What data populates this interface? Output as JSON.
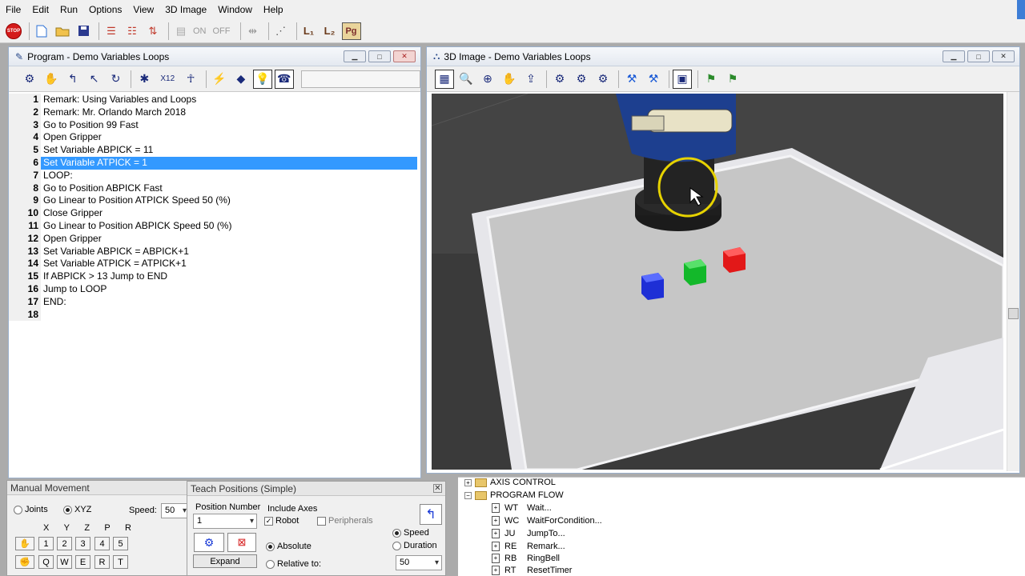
{
  "menu": [
    "File",
    "Edit",
    "Run",
    "Options",
    "View",
    "3D Image",
    "Window",
    "Help"
  ],
  "toolbar": {
    "stop_label": "STOP",
    "on_label": "ON",
    "off_label": "OFF",
    "pg_label": "Pg"
  },
  "program_window": {
    "title": "Program -  Demo Variables Loops",
    "selected_line": 6,
    "lines": [
      {
        "n": "1",
        "text": "Remark: Using Variables and Loops"
      },
      {
        "n": "2",
        "text": "Remark: Mr. Orlando     March 2018"
      },
      {
        "n": "3",
        "text": "Go to Position 99 Fast"
      },
      {
        "n": "4",
        "text": "Open Gripper"
      },
      {
        "n": "5",
        "text": "Set Variable ABPICK  = 11"
      },
      {
        "n": "6",
        "text": "Set Variable ATPICK  = 1"
      },
      {
        "n": "7",
        "text": "LOOP:"
      },
      {
        "n": "8",
        "text": "Go to Position ABPICK Fast"
      },
      {
        "n": "9",
        "text": "Go Linear to Position ATPICK Speed 50 (%)"
      },
      {
        "n": "10",
        "text": "Close Gripper"
      },
      {
        "n": "11",
        "text": "Go Linear to Position ABPICK Speed 50 (%)"
      },
      {
        "n": "12",
        "text": "Open Gripper"
      },
      {
        "n": "13",
        "text": "Set Variable ABPICK  = ABPICK+1"
      },
      {
        "n": "14",
        "text": "Set Variable ATPICK  = ATPICK+1"
      },
      {
        "n": "15",
        "text": "If ABPICK > 13 Jump to END"
      },
      {
        "n": "16",
        "text": "Jump to LOOP"
      },
      {
        "n": "17",
        "text": "END:"
      },
      {
        "n": "18",
        "text": ""
      }
    ],
    "tool_x12": "X12"
  },
  "image_window": {
    "title": "3D Image -  Demo Variables Loops"
  },
  "manual_movement": {
    "title": "Manual Movement",
    "joints_label": "Joints",
    "xyz_label": "XYZ",
    "speed_label": "Speed:",
    "speed_value": "50",
    "axes": [
      "X",
      "Y",
      "Z",
      "P",
      "R"
    ],
    "row1_keys": [
      "1",
      "2",
      "3",
      "4",
      "5"
    ],
    "row2_keys": [
      "Q",
      "W",
      "E",
      "R",
      "T"
    ]
  },
  "teach_positions": {
    "title": "Teach Positions (Simple)",
    "position_number_label": "Position Number",
    "position_number_value": "1",
    "include_axes_label": "Include Axes",
    "robot_label": "Robot",
    "peripherals_label": "Peripherals",
    "absolute_label": "Absolute",
    "relative_label": "Relative to:",
    "speed_label": "Speed",
    "duration_label": "Duration",
    "speed_value": "50",
    "expand_label": "Expand"
  },
  "command_tree": {
    "folders": [
      "AXIS CONTROL",
      "PROGRAM FLOW"
    ],
    "items": [
      {
        "code": "WT",
        "label": "Wait..."
      },
      {
        "code": "WC",
        "label": "WaitForCondition..."
      },
      {
        "code": "JU",
        "label": "JumpTo..."
      },
      {
        "code": "RE",
        "label": "Remark..."
      },
      {
        "code": "RB",
        "label": "RingBell"
      },
      {
        "code": "RT",
        "label": "ResetTimer"
      }
    ]
  }
}
